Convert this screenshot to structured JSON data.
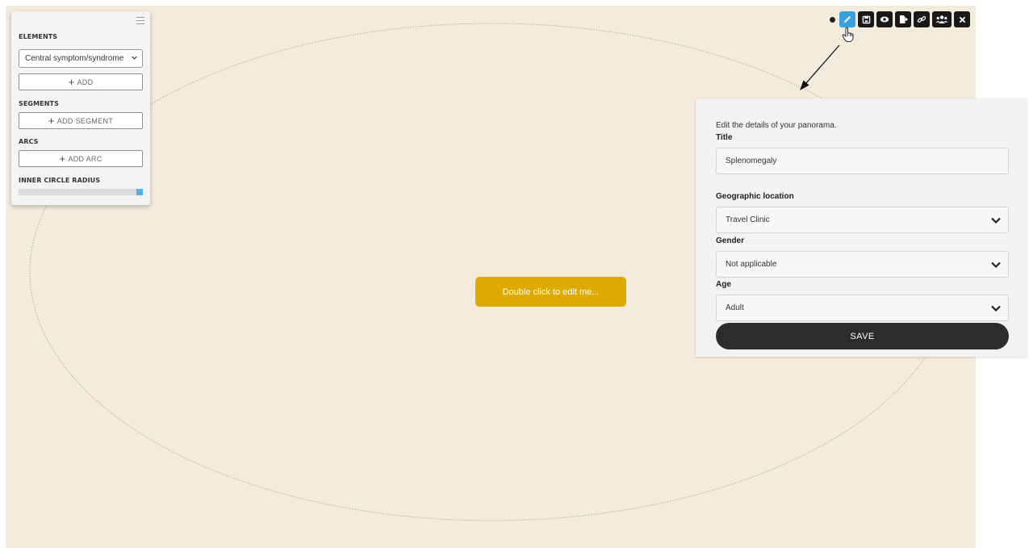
{
  "left_panel": {
    "elements_title": "ELEMENTS",
    "element_type_selected": "Central symptom/syndrome",
    "add_label": "ADD",
    "segments_title": "SEGMENTS",
    "add_segment_label": "ADD SEGMENT",
    "arcs_title": "ARCS",
    "add_arc_label": "ADD ARC",
    "inner_radius_title": "INNER CIRCLE RADIUS",
    "inner_radius_value": 1.0
  },
  "canvas": {
    "center_button_label": "Double click to edit me..."
  },
  "toolbar": {
    "tools": [
      "edit-icon",
      "save-icon",
      "preview-icon",
      "export-icon",
      "link-icon",
      "share-users-icon",
      "close-icon"
    ],
    "active_tool": "edit-icon"
  },
  "edit_panel": {
    "intro": "Edit the details of your panorama.",
    "title_label": "Title",
    "title_value": "Splenomegaly",
    "location_label": "Geographic location",
    "location_value": "Travel Clinic",
    "gender_label": "Gender",
    "gender_value": "Not applicable",
    "age_label": "Age",
    "age_value": "Adult",
    "save_label": "SAVE"
  },
  "colors": {
    "canvas_bg": "#f3ebdc",
    "center_button": "#dea900",
    "active_tool": "#3aa0dd",
    "save_button": "#2c2c2c"
  }
}
